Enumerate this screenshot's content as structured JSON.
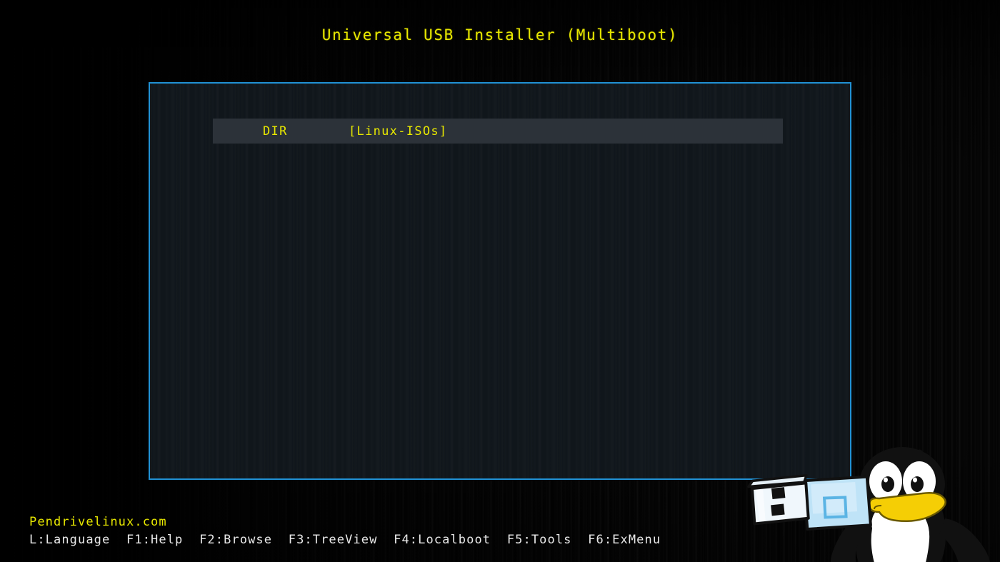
{
  "app": {
    "title": "Universal USB Installer (Multiboot)",
    "accent_border_color": "#2191d4",
    "text_color_highlight": "#e8e800",
    "text_color_normal": "#e9e9e9",
    "selection_background": "#2c3239",
    "background_color": "#050505"
  },
  "file_browser": {
    "rows": [
      {
        "type": "DIR",
        "name": "[Linux-ISOs]",
        "selected": true
      }
    ]
  },
  "footer": {
    "brand": "Pendrivelinux.com",
    "keys": [
      {
        "label": "L:Language"
      },
      {
        "label": "F1:Help"
      },
      {
        "label": "F2:Browse"
      },
      {
        "label": "F3:TreeView"
      },
      {
        "label": "F4:Localboot"
      },
      {
        "label": "F5:Tools"
      },
      {
        "label": "F6:ExMenu"
      }
    ],
    "separator": "  "
  },
  "mascot": {
    "penguin_body_color": "#111111",
    "penguin_belly_color": "#ffffff",
    "penguin_beak_color": "#f5ce05",
    "usb_body_color": "#bfe3f7",
    "usb_metal_color": "#f0f7fc",
    "usb_accent_color": "#6fc3ee",
    "alt_text": "Tux penguin holding a USB flash drive"
  }
}
